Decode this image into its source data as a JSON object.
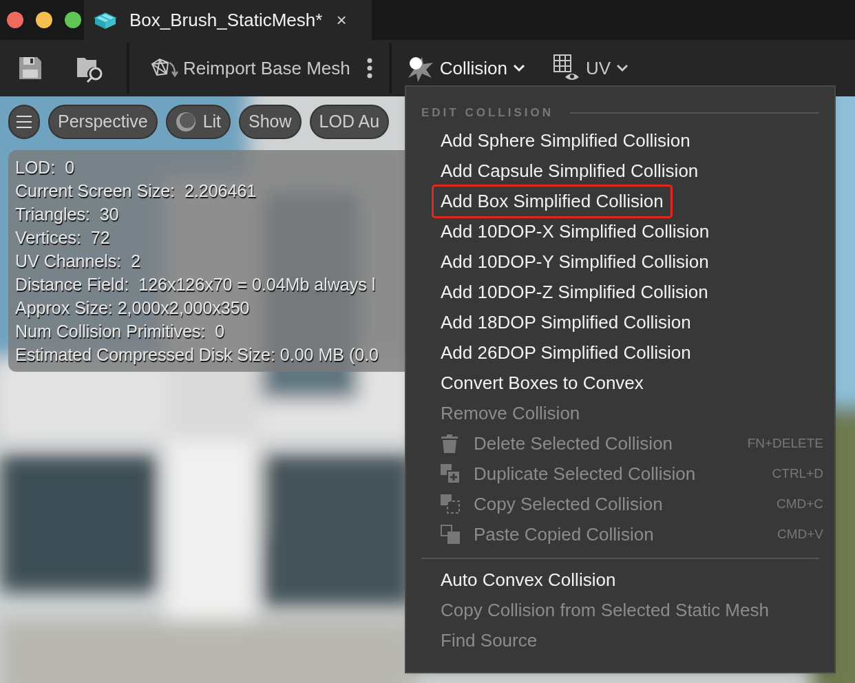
{
  "window": {
    "tab": {
      "title": "Box_Brush_StaticMesh*",
      "close": "×"
    }
  },
  "toolbar": {
    "reimport": "Reimport Base Mesh",
    "collision": "Collision",
    "uv": "UV"
  },
  "viewport": {
    "buttons": [
      {
        "kind": "menu"
      },
      {
        "kind": "text",
        "label": "Perspective"
      },
      {
        "kind": "lit",
        "label": "Lit"
      },
      {
        "kind": "text",
        "label": "Show"
      },
      {
        "kind": "text",
        "label": "LOD Au"
      }
    ],
    "stats": [
      "LOD:  0",
      "Current Screen Size:  2.206461",
      "Triangles:  30",
      "Vertices:  72",
      "UV Channels:  2",
      "Distance Field:  126x126x70 = 0.04Mb always l",
      "Approx Size: 2,000x2,000x350",
      "Num Collision Primitives:  0",
      "Estimated Compressed Disk Size: 0.00 MB (0.0"
    ]
  },
  "menu": {
    "sections": [
      {
        "header": "EDIT COLLISION",
        "items": [
          {
            "label": "Add Sphere Simplified Collision",
            "disabled": false,
            "highlighted": false
          },
          {
            "label": "Add Capsule Simplified Collision",
            "disabled": false,
            "highlighted": false
          },
          {
            "label": "Add Box Simplified Collision",
            "disabled": false,
            "highlighted": true
          },
          {
            "label": "Add 10DOP-X Simplified Collision",
            "disabled": false,
            "highlighted": false
          },
          {
            "label": "Add 10DOP-Y Simplified Collision",
            "disabled": false,
            "highlighted": false
          },
          {
            "label": "Add 10DOP-Z Simplified Collision",
            "disabled": false,
            "highlighted": false
          },
          {
            "label": "Add 18DOP Simplified Collision",
            "disabled": false,
            "highlighted": false
          },
          {
            "label": "Add 26DOP Simplified Collision",
            "disabled": false,
            "highlighted": false
          },
          {
            "label": "Convert Boxes to Convex",
            "disabled": false,
            "highlighted": false
          },
          {
            "label": "Remove Collision",
            "disabled": true,
            "highlighted": false
          },
          {
            "label": "Delete Selected Collision",
            "disabled": true,
            "highlighted": false,
            "kind": "tool",
            "shortcut": "FN+DELETE"
          },
          {
            "label": "Duplicate Selected Collision",
            "disabled": true,
            "highlighted": false,
            "kind": "tool",
            "shortcut": "CTRL+D"
          },
          {
            "label": "Copy Selected Collision",
            "disabled": true,
            "highlighted": false,
            "kind": "tool",
            "shortcut": "CMD+C"
          },
          {
            "label": "Paste Copied Collision",
            "disabled": true,
            "highlighted": false,
            "kind": "tool",
            "shortcut": "CMD+V"
          }
        ]
      },
      {
        "items": [
          {
            "label": "Auto Convex Collision",
            "disabled": false,
            "highlighted": false
          },
          {
            "label": "Copy Collision from Selected Static Mesh",
            "disabled": true,
            "highlighted": false
          },
          {
            "label": "Find Source",
            "disabled": true,
            "highlighted": false
          }
        ]
      }
    ]
  }
}
